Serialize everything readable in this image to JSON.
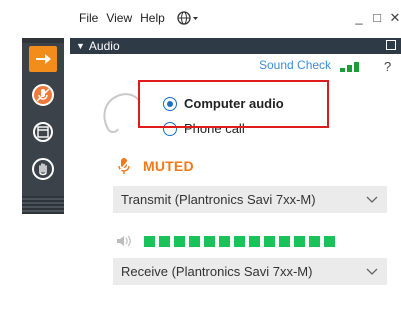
{
  "menubar": {
    "items": [
      "File",
      "View",
      "Help"
    ],
    "globe_icon": "globe-icon",
    "window_controls": [
      "_",
      "□",
      "✕"
    ]
  },
  "sidebar": {
    "buttons": [
      {
        "name": "collapse-arrow-button",
        "icon": "right-arrow-icon",
        "color": "#f28c1b"
      },
      {
        "name": "mute-mic-button",
        "icon": "muted-mic-icon",
        "color": "#f07a3c"
      },
      {
        "name": "window-button",
        "icon": "window-icon"
      },
      {
        "name": "raise-hand-button",
        "icon": "hand-icon"
      }
    ]
  },
  "audio_panel": {
    "title": "Audio",
    "sound_check": "Sound Check",
    "help": "?",
    "options": [
      {
        "label": "Computer audio",
        "selected": true
      },
      {
        "label": "Phone call",
        "selected": false
      }
    ],
    "status": "MUTED",
    "transmit_device": "Transmit (Plantronics Savi 7xx-M)",
    "receive_device": "Receive (Plantronics Savi 7xx-M)",
    "speaker_level_segments": 13
  },
  "colors": {
    "accent_orange": "#f07a1b",
    "link_blue": "#3a8dde",
    "meter_green": "#19c35a",
    "highlight_red": "#e11b1b",
    "header_bg": "#2f3a47"
  }
}
